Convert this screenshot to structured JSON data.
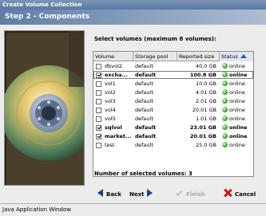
{
  "window": {
    "title": "Create Volume Collection",
    "status_text": "Java Application Window"
  },
  "wizard": {
    "step_title": "Step 2 - Components",
    "instruction": "Select volumes (maximum 8 volumes):"
  },
  "table": {
    "columns": [
      "Volume",
      "Storage pool",
      "Reported size",
      "Status"
    ],
    "sorted_column": "Status",
    "rows": [
      {
        "checked": false,
        "volume": "dbvol2",
        "pool": "default",
        "size": "40.0 GB",
        "status": "online",
        "bold": false,
        "selected": false
      },
      {
        "checked": true,
        "volume": "excha...",
        "pool": "default",
        "size": "100.8 GB",
        "status": "online",
        "bold": true,
        "selected": true
      },
      {
        "checked": false,
        "volume": "vol1",
        "pool": "default",
        "size": "10.0 GB",
        "status": "online",
        "bold": false,
        "selected": false
      },
      {
        "checked": false,
        "volume": "vol2",
        "pool": "default",
        "size": "4.01 GB",
        "status": "online",
        "bold": false,
        "selected": false
      },
      {
        "checked": false,
        "volume": "vol3",
        "pool": "default",
        "size": "2.01 GB",
        "status": "online",
        "bold": false,
        "selected": false
      },
      {
        "checked": false,
        "volume": "vol4",
        "pool": "default",
        "size": "20.01 GB",
        "status": "online",
        "bold": false,
        "selected": false
      },
      {
        "checked": false,
        "volume": "vol5",
        "pool": "default",
        "size": "1.01 GB",
        "status": "online",
        "bold": false,
        "selected": false
      },
      {
        "checked": true,
        "volume": "sqlvol",
        "pool": "default",
        "size": "23.01 GB",
        "status": "online",
        "bold": true,
        "selected": false
      },
      {
        "checked": true,
        "volume": "market...",
        "pool": "default",
        "size": "20.01 GB",
        "status": "online",
        "bold": true,
        "selected": false
      },
      {
        "checked": false,
        "volume": "test",
        "pool": "default",
        "size": "25.0 GB",
        "status": "online",
        "bold": false,
        "selected": false
      }
    ]
  },
  "selected_count_label": "Number of selected volumes:",
  "selected_count": "3",
  "buttons": {
    "back": "Back",
    "next": "Next",
    "finish": "Finish",
    "cancel": "Cancel"
  },
  "icons": {
    "status": "online-status-icon",
    "back": "arrow-left-icon",
    "next": "arrow-right-icon",
    "finish": "check-icon",
    "cancel": "x-icon"
  },
  "colors": {
    "titlebar": "#5878a3",
    "online": "#37a928",
    "cancel": "#d01010",
    "arrow": "#1e3e8c"
  }
}
